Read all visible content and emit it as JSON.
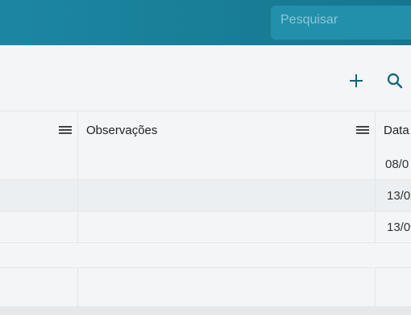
{
  "search": {
    "placeholder": "Pesquisar",
    "value": ""
  },
  "toolbar": {
    "add_icon": "plus-icon",
    "search_icon": "search-icon"
  },
  "grid": {
    "columns": [
      {
        "label": ""
      },
      {
        "label": "Observações"
      },
      {
        "label": "Data"
      }
    ],
    "rows": [
      {
        "observacoes": "",
        "data": "08/0"
      },
      {
        "observacoes": "",
        "data": "13/0"
      },
      {
        "observacoes": "",
        "data": "13/0"
      }
    ]
  },
  "colors": {
    "header_bg": "#1c86a1",
    "search_bg": "#2390ab",
    "icon": "#10657a",
    "page_bg": "#f3f5f7"
  }
}
